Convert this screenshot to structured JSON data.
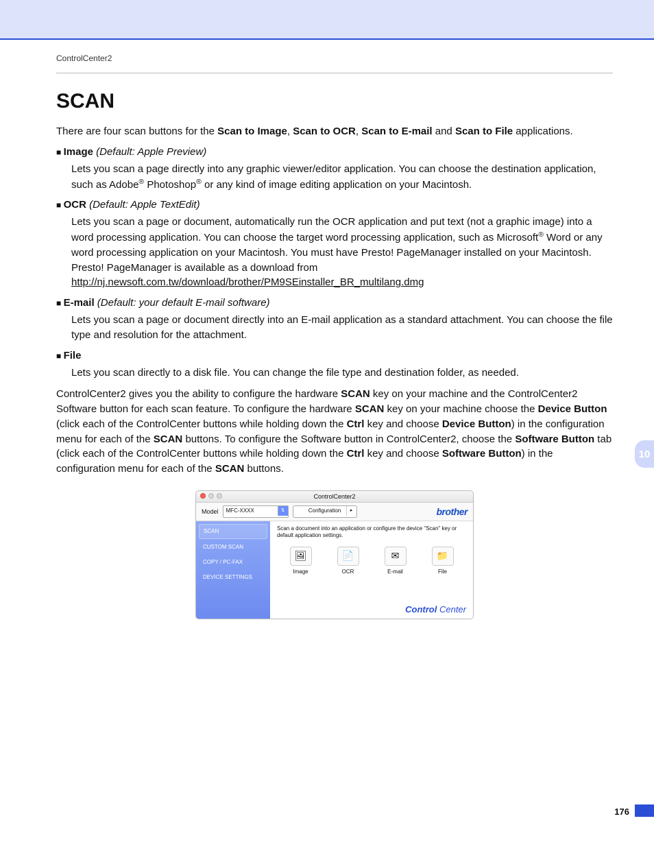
{
  "running_head": "ControlCenter2",
  "title": "SCAN",
  "intro": {
    "pre": "There are four scan buttons for the ",
    "b1": "Scan to Image",
    "sep1": ", ",
    "b2": "Scan to OCR",
    "sep2": ", ",
    "b3": "Scan to E-mail",
    "sep3": " and ",
    "b4": "Scan to File",
    "post": " applications."
  },
  "items": [
    {
      "head_bold": "Image",
      "head_italic": " (Default: Apple Preview)",
      "body_html": "Lets you scan a page directly into any graphic viewer/editor application. You can choose the destination application, such as Adobe<sup>®</sup> Photoshop<sup>®</sup> or any kind of image editing application on your Macintosh."
    },
    {
      "head_bold": "OCR",
      "head_italic": " (Default: Apple TextEdit)",
      "body_html": "Lets you scan a page or document, automatically run the OCR application and put text (not a graphic image) into a word processing application. You can choose the target word processing application, such as Microsoft<sup>®</sup> Word or any word processing application on your Macintosh. You must have Presto! PageManager installed on your Macintosh. Presto! PageManager is available as a download from <a href='#'>http://nj.newsoft.com.tw/download/brother/PM9SEinstaller_BR_multilang.dmg</a>"
    },
    {
      "head_bold": "E-mail",
      "head_italic": " (Default: your default E-mail software)",
      "body_html": "Lets you scan a page or document directly into an E-mail application as a standard attachment. You can choose the file type and resolution for the attachment."
    },
    {
      "head_bold": "File",
      "head_italic": "",
      "body_html": "Lets you scan directly to a disk file. You can change the file type and destination folder, as needed."
    }
  ],
  "para2_html": "ControlCenter2 gives you the ability to configure the hardware <b>SCAN</b> key on your machine and the ControlCenter2 Software button for each scan feature. To configure the hardware <b>SCAN</b> key on your machine choose the <b>Device Button</b> (click each of the ControlCenter buttons while holding down the <b>Ctrl</b> key and choose <b>Device Button</b>) in the configuration menu for each of the <b>SCAN</b> buttons. To configure the Software button in ControlCenter2, choose the <b>Software Button</b> tab (click each of the ControlCenter buttons while holding down the <b>Ctrl</b> key and choose <b>Software Button</b>) in the configuration menu for each of the <b>SCAN</b> buttons.",
  "side_tab": "10",
  "page_number": "176",
  "screenshot": {
    "window_title": "ControlCenter2",
    "model_label": "Model",
    "model_value": "MFC-XXXX",
    "config_label": "Configuration",
    "brand": "brother",
    "sidebar": [
      "SCAN",
      "CUSTOM SCAN",
      "COPY / PC-FAX",
      "DEVICE SETTINGS"
    ],
    "description": "Scan a document into an application or configure the device \"Scan\" key or default application settings.",
    "icons": [
      {
        "glyph": "🖼",
        "label": "Image"
      },
      {
        "glyph": "📄",
        "label": "OCR"
      },
      {
        "glyph": "✉",
        "label": "E-mail"
      },
      {
        "glyph": "📁",
        "label": "File"
      }
    ],
    "footer_bold": "Control",
    "footer_light": " Center"
  }
}
